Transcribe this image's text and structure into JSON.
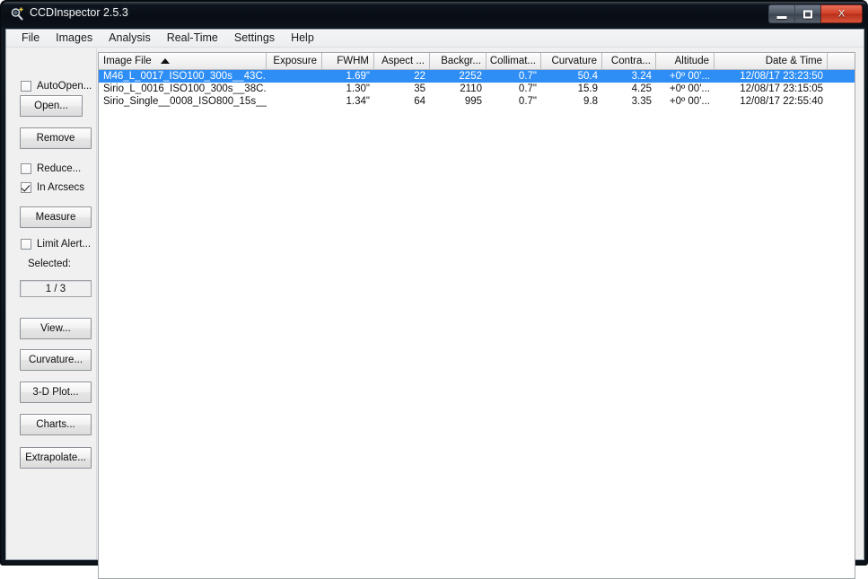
{
  "window": {
    "title": "CCDInspector 2.5.3",
    "icon": "magnifier-icon",
    "minimize_label": "Minimize",
    "maximize_label": "Maximize",
    "close_label": "X"
  },
  "menubar": {
    "items": [
      {
        "label": "File"
      },
      {
        "label": "Images"
      },
      {
        "label": "Analysis"
      },
      {
        "label": "Real-Time"
      },
      {
        "label": "Settings"
      },
      {
        "label": "Help"
      }
    ]
  },
  "sidebar": {
    "auto_open": {
      "label": "AutoOpen...",
      "checked": false
    },
    "open_button": "Open...",
    "remove_button": "Remove",
    "reduce": {
      "label": "Reduce...",
      "checked": false
    },
    "in_arcsecs": {
      "label": "In Arcsecs",
      "checked": true
    },
    "measure_button": "Measure",
    "limit_alert": {
      "label": "Limit Alert...",
      "checked": false
    },
    "selected_label": "Selected:",
    "selected_value": "1 / 3",
    "buttons": [
      {
        "label": "View..."
      },
      {
        "label": "Curvature..."
      },
      {
        "label": "3-D Plot..."
      },
      {
        "label": "Charts..."
      },
      {
        "label": "Extrapolate..."
      }
    ]
  },
  "table": {
    "sort_column": "Image File",
    "sort_direction": "ascending",
    "columns": [
      {
        "label": "Image File",
        "align": "left",
        "width": 187
      },
      {
        "label": "Exposure",
        "align": "right",
        "width": 62
      },
      {
        "label": "FWHM",
        "align": "right",
        "width": 58
      },
      {
        "label": "Aspect ...",
        "align": "right",
        "width": 62
      },
      {
        "label": "Backgr...",
        "align": "right",
        "width": 63
      },
      {
        "label": "Collimat...",
        "align": "right",
        "width": 61
      },
      {
        "label": "Curvature",
        "align": "right",
        "width": 68
      },
      {
        "label": "Contra...",
        "align": "right",
        "width": 60
      },
      {
        "label": "Altitude",
        "align": "right",
        "width": 65
      },
      {
        "label": "Date & Time",
        "align": "right",
        "width": 126
      },
      {
        "label": "",
        "align": "left",
        "width": 32
      }
    ],
    "rows": [
      {
        "selected": true,
        "cells": [
          "M46_L_0017_ISO100_300s__43C....",
          "",
          "1.69\"",
          "22",
          "2252",
          "0.7\"",
          "50.4",
          "3.24",
          "+0º 00'...",
          "12/08/17 23:23:50",
          ""
        ]
      },
      {
        "selected": false,
        "cells": [
          "Sirio_L_0016_ISO100_300s__38C....",
          "",
          "1.30\"",
          "35",
          "2110",
          "0.7\"",
          "15.9",
          "4.25",
          "+0º 00'...",
          "12/08/17 23:15:05",
          ""
        ]
      },
      {
        "selected": false,
        "cells": [
          "Sirio_Single__0008_ISO800_15s__...",
          "",
          "1.34\"",
          "64",
          "995",
          "0.7\"",
          "9.8",
          "3.35",
          "+0º 00'...",
          "12/08/17 22:55:40",
          ""
        ]
      }
    ]
  },
  "colors": {
    "selection": "#2f8ef5",
    "titlebar": "#0a0f16",
    "close_button": "#cf3f26",
    "panel": "#f0f0f0"
  }
}
